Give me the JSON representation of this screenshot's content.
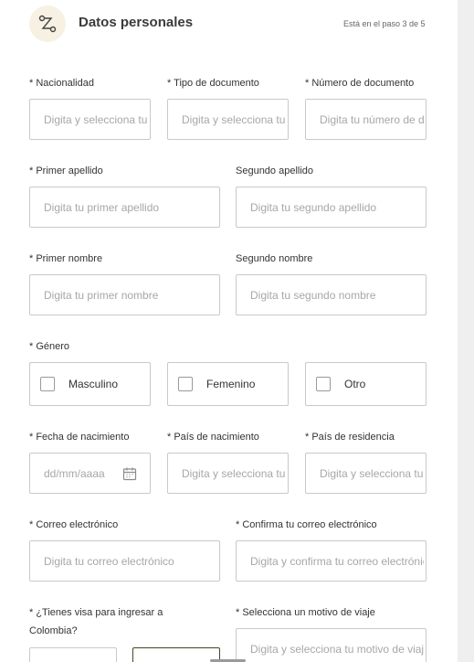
{
  "header": {
    "title": "Datos personales",
    "step": "Está en el paso 3 de 5",
    "icon": "route-icon"
  },
  "fields": {
    "nacionalidad": {
      "label": "* Nacionalidad",
      "placeholder": "Digita y selecciona tu nacionalidad"
    },
    "tipo_documento": {
      "label": "* Tipo de documento",
      "placeholder": "Digita y selecciona tu tipo de documento"
    },
    "numero_documento": {
      "label": "* Número de documento",
      "placeholder": "Digita tu número de documento"
    },
    "primer_apellido": {
      "label": "* Primer apellido",
      "placeholder": "Digita tu primer apellido"
    },
    "segundo_apellido": {
      "label": "Segundo apellido",
      "placeholder": "Digita tu segundo apellido"
    },
    "primer_nombre": {
      "label": "* Primer nombre",
      "placeholder": "Digita tu primer nombre"
    },
    "segundo_nombre": {
      "label": "Segundo nombre",
      "placeholder": "Digita tu segundo nombre"
    },
    "fecha_nacimiento": {
      "label": "* Fecha de nacimiento",
      "placeholder": "dd/mm/aaaa"
    },
    "pais_nacimiento": {
      "label": "* País de nacimiento",
      "placeholder": "Digita y selecciona tu país de nacimiento"
    },
    "pais_residencia": {
      "label": "* País de residencia",
      "placeholder": "Digita y selecciona tu país de residencia"
    },
    "correo": {
      "label": "* Correo electrónico",
      "placeholder": "Digita tu correo electrónico"
    },
    "confirma_correo": {
      "label": "* Confirma tu correo electrónico",
      "placeholder": "Digita y confirma tu correo electrónico"
    },
    "visa": {
      "label": "* ¿Tienes visa para ingresar a Colombia?"
    },
    "motivo_viaje": {
      "label": "* Selecciona un motivo de viaje",
      "placeholder": "Digita y selecciona tu motivo de viaje"
    }
  },
  "genero": {
    "label": "* Género",
    "options": [
      "Masculino",
      "Femenino",
      "Otro"
    ]
  },
  "colors": {
    "accent_dark": "#3e4a22",
    "icon_bg": "#f6f1e2",
    "border": "#c9c9c9"
  }
}
